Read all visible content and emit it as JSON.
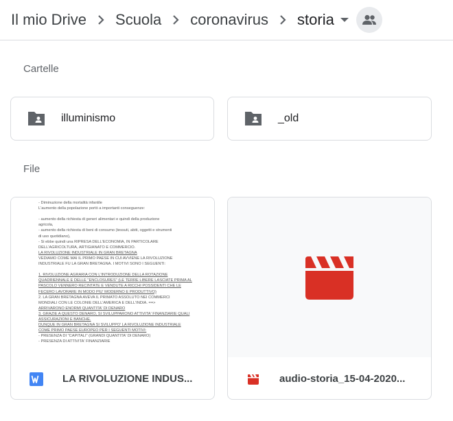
{
  "breadcrumb": {
    "items": [
      "Il mio Drive",
      "Scuola",
      "coronavirus",
      "storia"
    ],
    "separator_icon": "chevron-right-icon",
    "dropdown_icon": "arrow-drop-down-icon",
    "shared_icon": "people-icon"
  },
  "sections": {
    "folders_label": "Cartelle",
    "files_label": "File"
  },
  "folders": [
    {
      "name": "illuminismo",
      "icon": "shared-folder-icon"
    },
    {
      "name": "_old",
      "icon": "shared-folder-icon"
    }
  ],
  "files": [
    {
      "name": "LA RIVOLUZIONE INDUS...",
      "icon": "word-doc-icon",
      "thumbnail": "document-preview"
    },
    {
      "name": "audio-storia_15-04-2020...",
      "icon": "video-file-icon",
      "thumbnail": "video-clapperboard-icon"
    }
  ],
  "doc_preview": {
    "lines": [
      "- Diminuzione della mortalità infantile",
      "L'aumento della popolazione portò a importanti conseguenze:",
      "",
      "   -  aumento della richiesta di generi alimentari e quindi della produzione",
      "      agricola,",
      "   -  aumento della richiesta di beni di consumo (tessuti, abiti, oggetti e strumenti",
      "      di uso quotidiano),",
      "   -  Si ebbe quindi una RIPRESA DELL'ECONOMIA, IN PARTICOLARE",
      "      DELL'AGRICOLTURA, ARTIGIANATO E COMMERCIO.",
      "                  LA RIVOLUZIONE INDUSTRIALE IN GRAN BRETAGNA",
      "VEDIAMO COME MAI IL PRIMO PAESE IN CUI AVVIENE LA RIVOLUZIONE",
      "INDUSTRIALE FU LA GRAN BRETAGNA. I MOTIVI SONO I SEGUENTI:",
      "",
      "1. RIVOLUZIONE AGRARIA CON L'INTRODUZIONE DELLA ROTAZIONE",
      "   QUADRIENNALE E DELLE \"ENCLOSURES\" (LE TERRE LIBERE LASCIATE PRIMA AL",
      "   PASCOLO VENNERO RECINTATE E VENDUTE A RICCHI POSSIDENTI CHE LE",
      "   FECERO LAVORARE IN MODO PIU' MODERNO E PRODUTTIVO)",
      "2. LA GRAN BRETAGNA AVEVA IL PRIMATO ASSOLUTO NEI COMMERCI",
      "   MONDIALI CON LE COLONIE DELL'AMERICA E DELL'INDIA.    ==>",
      "   ARRIVARONO ENORMI QUANTITA' DI DENARO",
      "3. GRAZIE A QUESTO DENARO, SI SVILUPPARONO ATTIVITA' FINANZIARIE QUALI",
      "   ASSICURAZIONI E BANCHE.",
      "      DUNQUE IN GRAN BRETAGNA SI SVILUPPO' LA RIVOLUZIONE INDUSTRIALE",
      "                  COME PRIMO PAESE EUROPEO PER I SEGUENTI MOTIVI:",
      "   -  PRESENZA DI \"CAPITALI\" (GRANDI QUANTITA' DI DENARO)",
      "   -  PRESENZA DI ATTIVITA' FINANZIARIE"
    ]
  },
  "colors": {
    "text": "#202124",
    "muted": "#5f6368",
    "border": "#dadce0",
    "folder_icon": "#5f6368",
    "video_red": "#d93025",
    "word_blue": "#4285f4"
  }
}
